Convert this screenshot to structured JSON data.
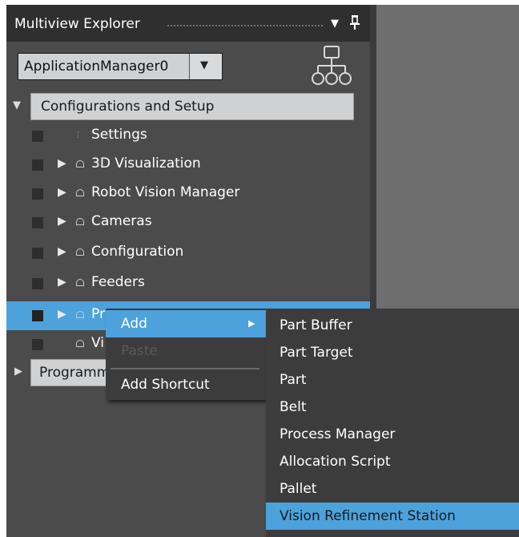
{
  "explorer": {
    "title": "Multiview Explorer",
    "chevron_glyph": "▼",
    "pin_glyph": "ᵖ",
    "app_selector_value": "ApplicationManager0",
    "app_selector_arrow": "▼"
  },
  "tree": {
    "config_header": "Configurations and Setup",
    "items": [
      {
        "label": "Settings",
        "icon": "settings-icon"
      },
      {
        "label": "3D Visualization",
        "icon": "lock-icon"
      },
      {
        "label": "Robot Vision Manager",
        "icon": "lock-icon"
      },
      {
        "label": "Cameras",
        "icon": "lock-icon"
      },
      {
        "label": "Configuration",
        "icon": "lock-icon"
      },
      {
        "label": "Feeders",
        "icon": "lock-icon"
      },
      {
        "label": "Pr",
        "icon": "lock-icon"
      },
      {
        "label": "Vi",
        "icon": "lock-icon"
      }
    ],
    "programming_header": "Programm"
  },
  "context_menu": {
    "add": "Add",
    "paste": "Paste",
    "add_shortcut": "Add Shortcut"
  },
  "submenu": {
    "items": [
      "Part Buffer",
      "Part Target",
      "Part",
      "Belt",
      "Process Manager",
      "Allocation Script",
      "Pallet",
      "Vision Refinement Station"
    ]
  },
  "colors": {
    "accent": "#4da2dc",
    "panel_bg": "#4b4b4b",
    "menu_bg": "#3c3c3c"
  }
}
